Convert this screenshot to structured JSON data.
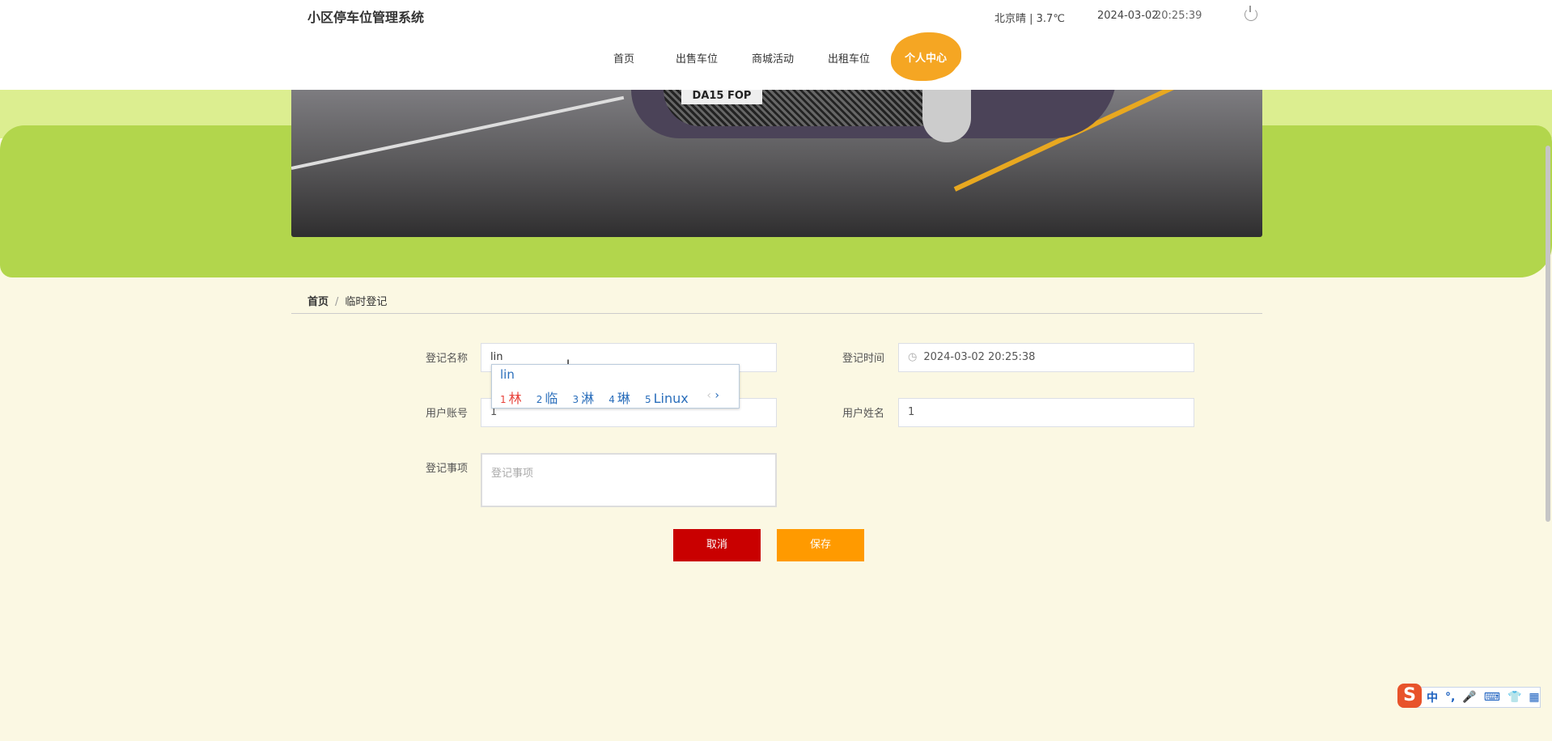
{
  "header": {
    "title": "小区停车位管理系统",
    "weather": "北京晴 | 3.7℃",
    "date": "2024-03-02",
    "time": "20:25:39"
  },
  "nav": [
    "首页",
    "出售车位",
    "商城活动",
    "出租车位",
    "个人中心"
  ],
  "banner": {
    "plate": "DA15 FOP"
  },
  "breadcrumb": {
    "home": "首页",
    "separator": "/",
    "current": "临时登记"
  },
  "form": {
    "name_label": "登记名称",
    "name_value": "lin",
    "time_label": "登记时间",
    "time_value": "2024-03-02 20:25:38",
    "account_label": "用户账号",
    "account_value": "1",
    "username_label": "用户姓名",
    "username_value": "1",
    "notes_label": "登记事项",
    "notes_placeholder": "登记事项",
    "cancel": "取消",
    "save": "保存"
  },
  "ime": {
    "pinyin": "lin",
    "candidates": [
      {
        "n": "1",
        "t": "林"
      },
      {
        "n": "2",
        "t": "临"
      },
      {
        "n": "3",
        "t": "淋"
      },
      {
        "n": "4",
        "t": "琳"
      },
      {
        "n": "5",
        "t": "Linux"
      }
    ],
    "prev": "‹",
    "next": "›"
  },
  "ime_toolbar": {
    "logo": "S",
    "mode": "中",
    "punct": "°,",
    "items": [
      "🎤",
      "⌨",
      "👕",
      "▦"
    ]
  }
}
